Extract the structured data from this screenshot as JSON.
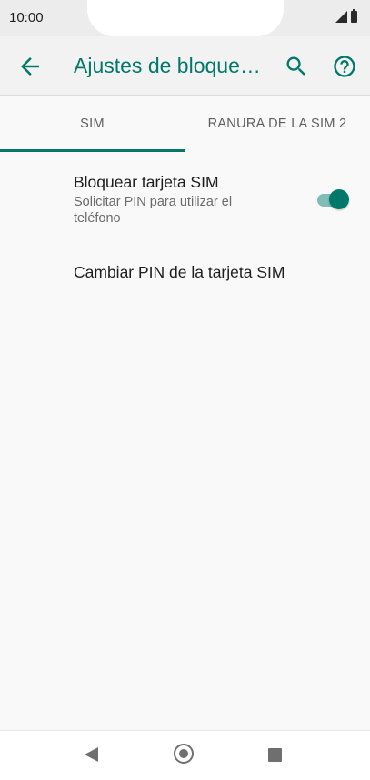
{
  "status_bar": {
    "time": "10:00"
  },
  "app_bar": {
    "title": "Ajustes de bloqueo de SIM",
    "back_icon": "arrow-left-icon",
    "search_icon": "search-icon",
    "help_icon": "help-circle-icon",
    "accent_color": "#00796b"
  },
  "tabs": [
    {
      "label": "SIM",
      "selected": true
    },
    {
      "label": "RANURA DE LA SIM 2",
      "selected": false
    }
  ],
  "settings": {
    "lock_sim": {
      "title": "Bloquear tarjeta SIM",
      "subtitle": "Solicitar PIN para utilizar el teléfono",
      "enabled": true
    },
    "change_pin": {
      "title": "Cambiar PIN de la tarjeta SIM"
    }
  },
  "nav_bar": {
    "back_icon": "nav-back-icon",
    "home_icon": "nav-home-icon",
    "recents_icon": "nav-recents-icon"
  }
}
